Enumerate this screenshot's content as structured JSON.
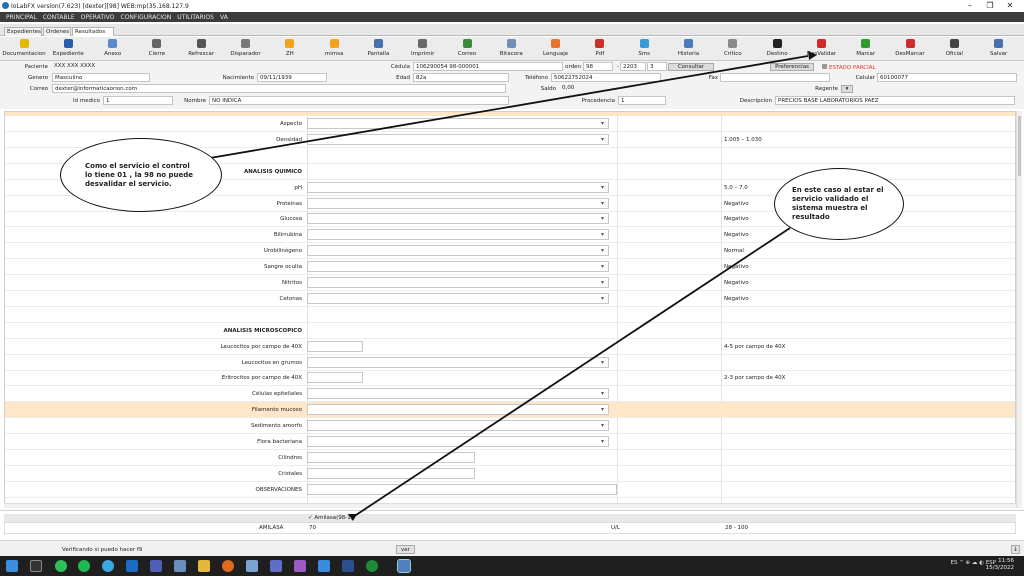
{
  "window": {
    "title": "IoLabFX version(7.623)  [dexter][98] WEB:mp(35.168.127.9",
    "controls": [
      "–",
      "❐",
      "✕"
    ]
  },
  "menu": [
    "PRINCIPAL",
    "CONTABLE",
    "OPERATIVO",
    "CONFIGURACION",
    "UTILITARIOS",
    "VA"
  ],
  "tabs": [
    "Expedientes",
    "Ordenes",
    "Resultados ×"
  ],
  "toolbar": [
    {
      "label": "Documentacion",
      "icon": "documentation-icon",
      "color": "#e6b800"
    },
    {
      "label": "Expediente",
      "icon": "person-icon",
      "color": "#2a5cab"
    },
    {
      "label": "Anexo",
      "icon": "attachment-icon",
      "color": "#5b8bc7"
    },
    {
      "label": "Cierre",
      "icon": "close-order-icon",
      "color": "#666666"
    },
    {
      "label": "Refrescar",
      "icon": "refresh-icon",
      "color": "#555555"
    },
    {
      "label": "Disparador",
      "icon": "trigger-icon",
      "color": "#777777"
    },
    {
      "label": "ZH",
      "icon": "sun-icon",
      "color": "#f2a51a"
    },
    {
      "label": "mimsa",
      "icon": "sun-icon",
      "color": "#f2a51a"
    },
    {
      "label": "Pantalla",
      "icon": "screen-icon",
      "color": "#4a6fae"
    },
    {
      "label": "Imprimir",
      "icon": "print-icon",
      "color": "#6a6a6a"
    },
    {
      "label": "Correo",
      "icon": "mail-icon",
      "color": "#3d8a3d"
    },
    {
      "label": "Bitacora",
      "icon": "search-icon",
      "color": "#6f8fb5"
    },
    {
      "label": "Lenguaje",
      "icon": "language-icon",
      "color": "#e8732a"
    },
    {
      "label": "Pdf",
      "icon": "pdf-icon",
      "color": "#c9302c"
    },
    {
      "label": "Sms",
      "icon": "sms-icon",
      "color": "#3b9ad9"
    },
    {
      "label": "Historia",
      "icon": "history-icon",
      "color": "#4a7bbf"
    },
    {
      "label": "Critico",
      "icon": "critical-icon",
      "color": "#8a8a8a"
    },
    {
      "label": "Destino",
      "icon": "destination-icon",
      "color": "#222222"
    },
    {
      "label": "DesValidar",
      "icon": "unvalidate-icon",
      "color": "#d12a2a"
    },
    {
      "label": "Marcar",
      "icon": "checkmark-icon",
      "color": "#2f9a2f"
    },
    {
      "label": "DesMarcar",
      "icon": "unmark-icon",
      "color": "#d12a2a"
    },
    {
      "label": "Oficial",
      "icon": "official-icon",
      "color": "#444444"
    },
    {
      "label": "Salvar",
      "icon": "save-icon",
      "color": "#4a6fae"
    }
  ],
  "header": {
    "paciente_label": "Paciente",
    "paciente": "XXX XXX XXXX",
    "cedula_label": "Cédula",
    "cedula": "106290054  98-000001",
    "orden_label": "orden",
    "orden_a": "98",
    "orden_b": "2203",
    "orden_c": "3",
    "consultar": "Consultar",
    "preferencias": "Preferencias",
    "estado": "ESTADO PARCIAL",
    "genero_label": "Genero",
    "genero": "Masculino",
    "nacimiento_label": "Nacimiento",
    "nacimiento": "09/11/1939",
    "edad_label": "Edad",
    "edad": "82a",
    "telefono_label": "Teléfono",
    "telefono": "50622752024",
    "fax_label": "Fax",
    "fax": "",
    "celular_label": "Celular",
    "celular": "60100077",
    "correo_label": "Correo",
    "correo": "dexter@informaticaorion.com",
    "saldo_label": "Saldo",
    "saldo": "0,00",
    "regente_label": "Regente",
    "regente": "",
    "idmedico_label": "Id medico",
    "idmedico": "1",
    "nombre_label": "Nombre",
    "nombre": "NO INDICA",
    "procedencia_label": "Procedencia",
    "procedencia": "1",
    "descripcion_label": "Descripcion",
    "descripcion": "PRECIOS BASE LABORATORIOS PAEZ"
  },
  "rows": [
    {
      "label": "Aspecto",
      "type": "select",
      "ref": ""
    },
    {
      "label": "Densidad",
      "type": "select",
      "ref": "1.005 – 1.030"
    },
    {
      "label": "",
      "type": "blank",
      "ref": ""
    },
    {
      "label": "ANALISIS QUIMICO",
      "type": "section",
      "ref": ""
    },
    {
      "label": "pH",
      "type": "select",
      "ref": "5.0 – 7.0"
    },
    {
      "label": "Proteinas",
      "type": "select",
      "ref": "Negativo"
    },
    {
      "label": "Glucosa",
      "type": "select",
      "ref": "Negativo"
    },
    {
      "label": "Bilirrubina",
      "type": "select",
      "ref": "Negativo"
    },
    {
      "label": "Urobilinógeno",
      "type": "select",
      "ref": "Normal"
    },
    {
      "label": "Sangre oculta",
      "type": "select",
      "ref": "Negativo"
    },
    {
      "label": "Nitritos",
      "type": "select",
      "ref": "Negativo"
    },
    {
      "label": "Cetonas",
      "type": "select",
      "ref": "Negativo"
    },
    {
      "label": "",
      "type": "blank",
      "ref": ""
    },
    {
      "label": "ANALISIS MICROSCOPICO",
      "type": "section",
      "ref": ""
    },
    {
      "label": "Leucocitos por campo de 40X",
      "type": "short",
      "ref": "4-5 por campo de 40X"
    },
    {
      "label": "Leucocitos en grumos",
      "type": "select",
      "ref": ""
    },
    {
      "label": "Eritrocitos por campo de 40X",
      "type": "short",
      "ref": "2-3 por campo de 40X"
    },
    {
      "label": "Células epiteliales",
      "type": "select",
      "ref": ""
    },
    {
      "label": "Filamento mucoso",
      "type": "select",
      "ref": "",
      "highlight": true
    },
    {
      "label": "Sedimento amorfo",
      "type": "select",
      "ref": ""
    },
    {
      "label": "Flora bacteriana",
      "type": "select",
      "ref": ""
    },
    {
      "label": "Cilindros",
      "type": "medium",
      "ref": ""
    },
    {
      "label": "Cristales",
      "type": "medium",
      "ref": ""
    },
    {
      "label": "OBSERVACIONES",
      "type": "long",
      "ref": ""
    }
  ],
  "panel2": {
    "header": "Amilasa(98-1)",
    "label": "AMILASA",
    "value": "70",
    "unit": "U/L",
    "range": "28 - 100"
  },
  "status": {
    "text": "Verificando si puedo hacer f9",
    "ver": "ver"
  },
  "annotations": {
    "left": "Como el servicio el control lo tiene 01 , la 98 no puede desvalidar el servicio.",
    "right": "En este caso al estar el servicio validado el sistema muestra el resultado"
  },
  "taskbar": {
    "tray": "ES  ^  ⊕  ☁  ◐  ESP",
    "time": "11:56",
    "date": "15/3/2022"
  }
}
